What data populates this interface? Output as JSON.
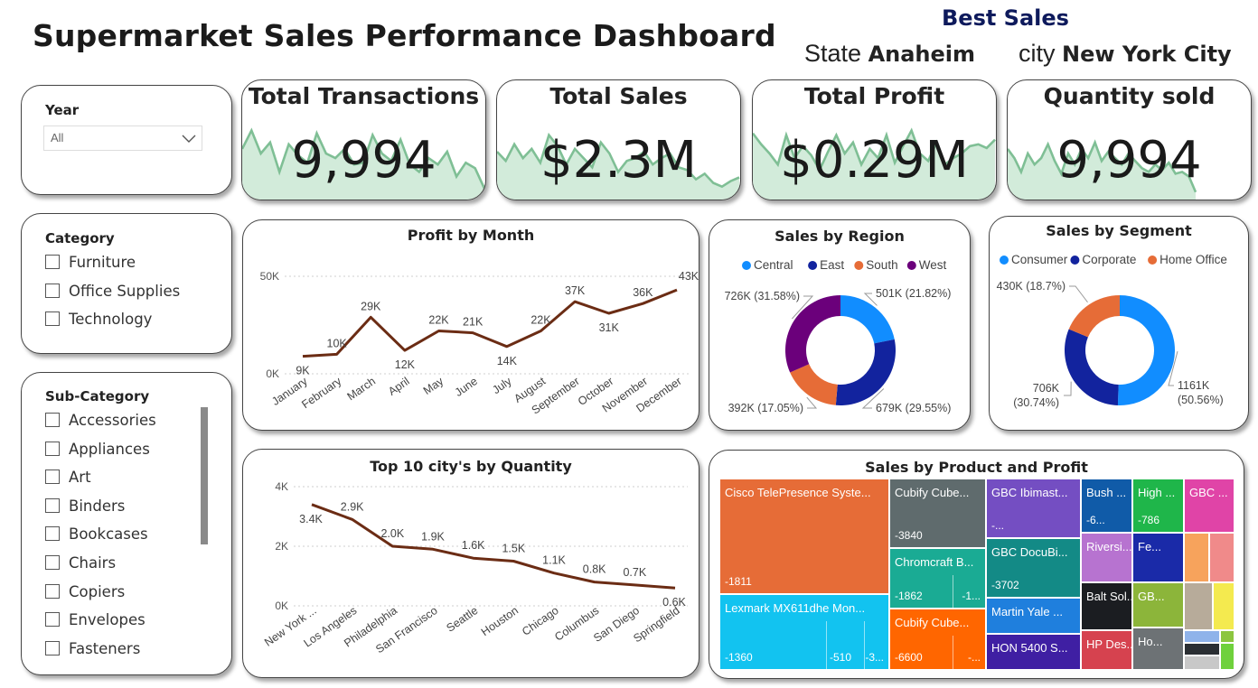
{
  "dashboard_title": "Supermarket Sales Performance Dashboard",
  "best_sales": {
    "title": "Best Sales",
    "state_label": "State",
    "state_value": "Anaheim",
    "city_label": "city",
    "city_value": "New York City"
  },
  "kpis": [
    {
      "title": "Total Transactions",
      "value": "9,994"
    },
    {
      "title": "Total Sales",
      "value": "$2.3M"
    },
    {
      "title": "Total Profit",
      "value": "$0.29M"
    },
    {
      "title": "Quantity sold",
      "value": "9,994"
    }
  ],
  "colors": {
    "spark_line": "#7fbf95",
    "spark_fill": "#d2ebda",
    "line": "#6b2c14"
  },
  "slicers": {
    "year": {
      "title": "Year",
      "selected": "All"
    },
    "category": {
      "title": "Category",
      "items": [
        "Furniture",
        "Office Supplies",
        "Technology"
      ]
    },
    "subcategory": {
      "title": "Sub-Category",
      "items": [
        "Accessories",
        "Appliances",
        "Art",
        "Binders",
        "Bookcases",
        "Chairs",
        "Copiers",
        "Envelopes",
        "Fasteners"
      ]
    }
  },
  "chart_data": [
    {
      "type": "line",
      "title": "Profit by Month",
      "categories": [
        "January",
        "February",
        "March",
        "April",
        "May",
        "June",
        "July",
        "August",
        "September",
        "October",
        "November",
        "December"
      ],
      "values": [
        9,
        10,
        29,
        12,
        22,
        21,
        14,
        22,
        37,
        31,
        36,
        43
      ],
      "data_labels": [
        "9K",
        "10K",
        "29K",
        "12K",
        "22K",
        "21K",
        "14K",
        "22K",
        "37K",
        "31K",
        "36K",
        "43K"
      ],
      "yticks": [
        "0K",
        "50K"
      ],
      "ylim": [
        0,
        50
      ],
      "grid": true
    },
    {
      "type": "pie",
      "title": "Sales by Region",
      "legend": [
        "Central",
        "East",
        "South",
        "West"
      ],
      "legend_colors": [
        "#118dff",
        "#12239e",
        "#e66c37",
        "#6b007b"
      ],
      "slices": [
        {
          "name": "Central",
          "value": 501,
          "label": "501K (21.82%)",
          "color": "#118dff"
        },
        {
          "name": "East",
          "value": 679,
          "label": "679K (29.55%)",
          "color": "#12239e"
        },
        {
          "name": "South",
          "value": 392,
          "label": "392K (17.05%)",
          "color": "#e66c37"
        },
        {
          "name": "West",
          "value": 726,
          "label": "726K (31.58%)",
          "color": "#6b007b"
        }
      ],
      "legend_placement": "top"
    },
    {
      "type": "pie",
      "title": "Sales by Segment",
      "legend": [
        "Consumer",
        "Corporate",
        "Home Office"
      ],
      "legend_colors": [
        "#118dff",
        "#12239e",
        "#e66c37"
      ],
      "slices": [
        {
          "name": "Consumer",
          "value": 1161,
          "label": "1161K (50.56%)",
          "color": "#118dff"
        },
        {
          "name": "Corporate",
          "value": 706,
          "label": "706K (30.74%)",
          "color": "#12239e"
        },
        {
          "name": "Home Office",
          "value": 430,
          "label": "430K (18.7%)",
          "color": "#e66c37"
        }
      ],
      "legend_placement": "top"
    },
    {
      "type": "line",
      "title": "Top 10 city's by Quantity",
      "categories": [
        "New York ...",
        "Los Angeles",
        "Philadelphia",
        "San Francisco",
        "Seattle",
        "Houston",
        "Chicago",
        "Columbus",
        "San Diego",
        "Springfield"
      ],
      "values": [
        3.4,
        2.9,
        2.0,
        1.9,
        1.6,
        1.5,
        1.1,
        0.8,
        0.7,
        0.6
      ],
      "data_labels": [
        "3.4K",
        "2.9K",
        "2.0K",
        "1.9K",
        "1.6K",
        "1.5K",
        "1.1K",
        "0.8K",
        "0.7K",
        "0.6K"
      ],
      "yticks": [
        "0K",
        "2K",
        "4K"
      ],
      "ylim": [
        0,
        4
      ],
      "grid": true
    }
  ],
  "treemap": {
    "title": "Sales by Product and Profit",
    "cells": [
      {
        "label": "Cisco TelePresence Syste...",
        "value": "-1811",
        "color": "#e66c37"
      },
      {
        "label": "Lexmark MX611dhe Mon...",
        "value": "-1360",
        "extra": [
          "-510",
          "-3..."
        ],
        "color": "#12c3f0"
      },
      {
        "label": "Cubify Cube...",
        "value": "-3840",
        "color": "#5f6b6d"
      },
      {
        "label": "Chromcraft B...",
        "value": "-1862",
        "extra": [
          "-1..."
        ],
        "color": "#1aab94"
      },
      {
        "label": "Cubify Cube...",
        "value": "-6600",
        "extra": [
          "-..."
        ],
        "color": "#ff6600"
      },
      {
        "label": "GBC Ibimast...",
        "value": "-...",
        "color": "#744ec2"
      },
      {
        "label": "GBC DocuBi...",
        "value": "-3702",
        "color": "#138a86"
      },
      {
        "label": "Martin Yale ...",
        "value": "",
        "color": "#1f7fdd"
      },
      {
        "label": "HON 5400 S...",
        "value": "",
        "color": "#3f1fa3"
      },
      {
        "label": "Bush ...",
        "value": "-6...",
        "color": "#105ba8"
      },
      {
        "label": "High ...",
        "value": "-786",
        "color": "#1fb64a"
      },
      {
        "label": "GBC ...",
        "value": "",
        "color": "#e044a7"
      },
      {
        "label": "Riversi...",
        "value": "",
        "color": "#b773d0"
      },
      {
        "label": "Fe...",
        "value": "",
        "color": "#1a2aa8"
      },
      {
        "label": "Balt Sol...",
        "value": "",
        "color": "#1b1d21"
      },
      {
        "label": "HP Des...",
        "value": "",
        "color": "#d6424f"
      },
      {
        "label": "GB...",
        "value": "",
        "color": "#8cb53a"
      },
      {
        "label": "Ho...",
        "value": "",
        "color": "#6d7275"
      }
    ]
  }
}
